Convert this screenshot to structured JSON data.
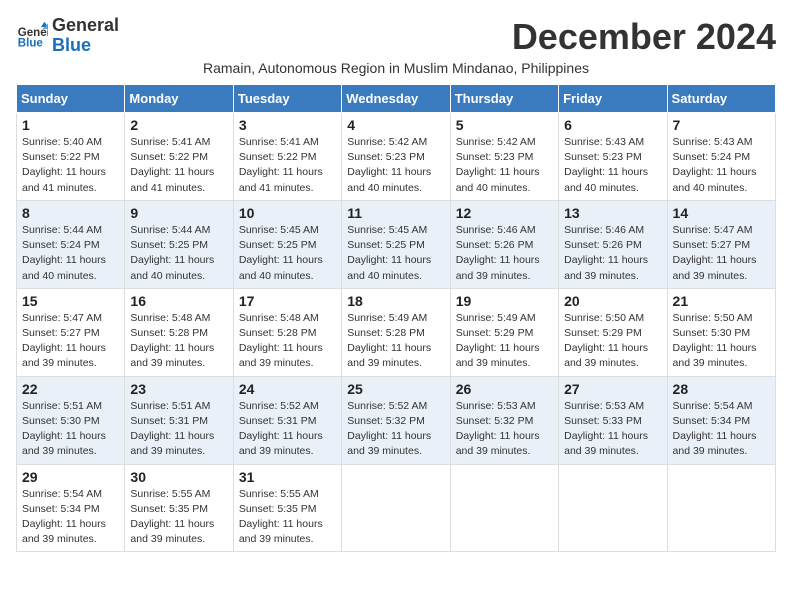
{
  "header": {
    "logo_line1": "General",
    "logo_line2": "Blue",
    "month_title": "December 2024",
    "subtitle": "Ramain, Autonomous Region in Muslim Mindanao, Philippines"
  },
  "weekdays": [
    "Sunday",
    "Monday",
    "Tuesday",
    "Wednesday",
    "Thursday",
    "Friday",
    "Saturday"
  ],
  "weeks": [
    [
      {
        "day": "1",
        "sunrise": "Sunrise: 5:40 AM",
        "sunset": "Sunset: 5:22 PM",
        "daylight": "Daylight: 11 hours and 41 minutes."
      },
      {
        "day": "2",
        "sunrise": "Sunrise: 5:41 AM",
        "sunset": "Sunset: 5:22 PM",
        "daylight": "Daylight: 11 hours and 41 minutes."
      },
      {
        "day": "3",
        "sunrise": "Sunrise: 5:41 AM",
        "sunset": "Sunset: 5:22 PM",
        "daylight": "Daylight: 11 hours and 41 minutes."
      },
      {
        "day": "4",
        "sunrise": "Sunrise: 5:42 AM",
        "sunset": "Sunset: 5:23 PM",
        "daylight": "Daylight: 11 hours and 40 minutes."
      },
      {
        "day": "5",
        "sunrise": "Sunrise: 5:42 AM",
        "sunset": "Sunset: 5:23 PM",
        "daylight": "Daylight: 11 hours and 40 minutes."
      },
      {
        "day": "6",
        "sunrise": "Sunrise: 5:43 AM",
        "sunset": "Sunset: 5:23 PM",
        "daylight": "Daylight: 11 hours and 40 minutes."
      },
      {
        "day": "7",
        "sunrise": "Sunrise: 5:43 AM",
        "sunset": "Sunset: 5:24 PM",
        "daylight": "Daylight: 11 hours and 40 minutes."
      }
    ],
    [
      {
        "day": "8",
        "sunrise": "Sunrise: 5:44 AM",
        "sunset": "Sunset: 5:24 PM",
        "daylight": "Daylight: 11 hours and 40 minutes."
      },
      {
        "day": "9",
        "sunrise": "Sunrise: 5:44 AM",
        "sunset": "Sunset: 5:25 PM",
        "daylight": "Daylight: 11 hours and 40 minutes."
      },
      {
        "day": "10",
        "sunrise": "Sunrise: 5:45 AM",
        "sunset": "Sunset: 5:25 PM",
        "daylight": "Daylight: 11 hours and 40 minutes."
      },
      {
        "day": "11",
        "sunrise": "Sunrise: 5:45 AM",
        "sunset": "Sunset: 5:25 PM",
        "daylight": "Daylight: 11 hours and 40 minutes."
      },
      {
        "day": "12",
        "sunrise": "Sunrise: 5:46 AM",
        "sunset": "Sunset: 5:26 PM",
        "daylight": "Daylight: 11 hours and 39 minutes."
      },
      {
        "day": "13",
        "sunrise": "Sunrise: 5:46 AM",
        "sunset": "Sunset: 5:26 PM",
        "daylight": "Daylight: 11 hours and 39 minutes."
      },
      {
        "day": "14",
        "sunrise": "Sunrise: 5:47 AM",
        "sunset": "Sunset: 5:27 PM",
        "daylight": "Daylight: 11 hours and 39 minutes."
      }
    ],
    [
      {
        "day": "15",
        "sunrise": "Sunrise: 5:47 AM",
        "sunset": "Sunset: 5:27 PM",
        "daylight": "Daylight: 11 hours and 39 minutes."
      },
      {
        "day": "16",
        "sunrise": "Sunrise: 5:48 AM",
        "sunset": "Sunset: 5:28 PM",
        "daylight": "Daylight: 11 hours and 39 minutes."
      },
      {
        "day": "17",
        "sunrise": "Sunrise: 5:48 AM",
        "sunset": "Sunset: 5:28 PM",
        "daylight": "Daylight: 11 hours and 39 minutes."
      },
      {
        "day": "18",
        "sunrise": "Sunrise: 5:49 AM",
        "sunset": "Sunset: 5:28 PM",
        "daylight": "Daylight: 11 hours and 39 minutes."
      },
      {
        "day": "19",
        "sunrise": "Sunrise: 5:49 AM",
        "sunset": "Sunset: 5:29 PM",
        "daylight": "Daylight: 11 hours and 39 minutes."
      },
      {
        "day": "20",
        "sunrise": "Sunrise: 5:50 AM",
        "sunset": "Sunset: 5:29 PM",
        "daylight": "Daylight: 11 hours and 39 minutes."
      },
      {
        "day": "21",
        "sunrise": "Sunrise: 5:50 AM",
        "sunset": "Sunset: 5:30 PM",
        "daylight": "Daylight: 11 hours and 39 minutes."
      }
    ],
    [
      {
        "day": "22",
        "sunrise": "Sunrise: 5:51 AM",
        "sunset": "Sunset: 5:30 PM",
        "daylight": "Daylight: 11 hours and 39 minutes."
      },
      {
        "day": "23",
        "sunrise": "Sunrise: 5:51 AM",
        "sunset": "Sunset: 5:31 PM",
        "daylight": "Daylight: 11 hours and 39 minutes."
      },
      {
        "day": "24",
        "sunrise": "Sunrise: 5:52 AM",
        "sunset": "Sunset: 5:31 PM",
        "daylight": "Daylight: 11 hours and 39 minutes."
      },
      {
        "day": "25",
        "sunrise": "Sunrise: 5:52 AM",
        "sunset": "Sunset: 5:32 PM",
        "daylight": "Daylight: 11 hours and 39 minutes."
      },
      {
        "day": "26",
        "sunrise": "Sunrise: 5:53 AM",
        "sunset": "Sunset: 5:32 PM",
        "daylight": "Daylight: 11 hours and 39 minutes."
      },
      {
        "day": "27",
        "sunrise": "Sunrise: 5:53 AM",
        "sunset": "Sunset: 5:33 PM",
        "daylight": "Daylight: 11 hours and 39 minutes."
      },
      {
        "day": "28",
        "sunrise": "Sunrise: 5:54 AM",
        "sunset": "Sunset: 5:34 PM",
        "daylight": "Daylight: 11 hours and 39 minutes."
      }
    ],
    [
      {
        "day": "29",
        "sunrise": "Sunrise: 5:54 AM",
        "sunset": "Sunset: 5:34 PM",
        "daylight": "Daylight: 11 hours and 39 minutes."
      },
      {
        "day": "30",
        "sunrise": "Sunrise: 5:55 AM",
        "sunset": "Sunset: 5:35 PM",
        "daylight": "Daylight: 11 hours and 39 minutes."
      },
      {
        "day": "31",
        "sunrise": "Sunrise: 5:55 AM",
        "sunset": "Sunset: 5:35 PM",
        "daylight": "Daylight: 11 hours and 39 minutes."
      },
      null,
      null,
      null,
      null
    ]
  ]
}
